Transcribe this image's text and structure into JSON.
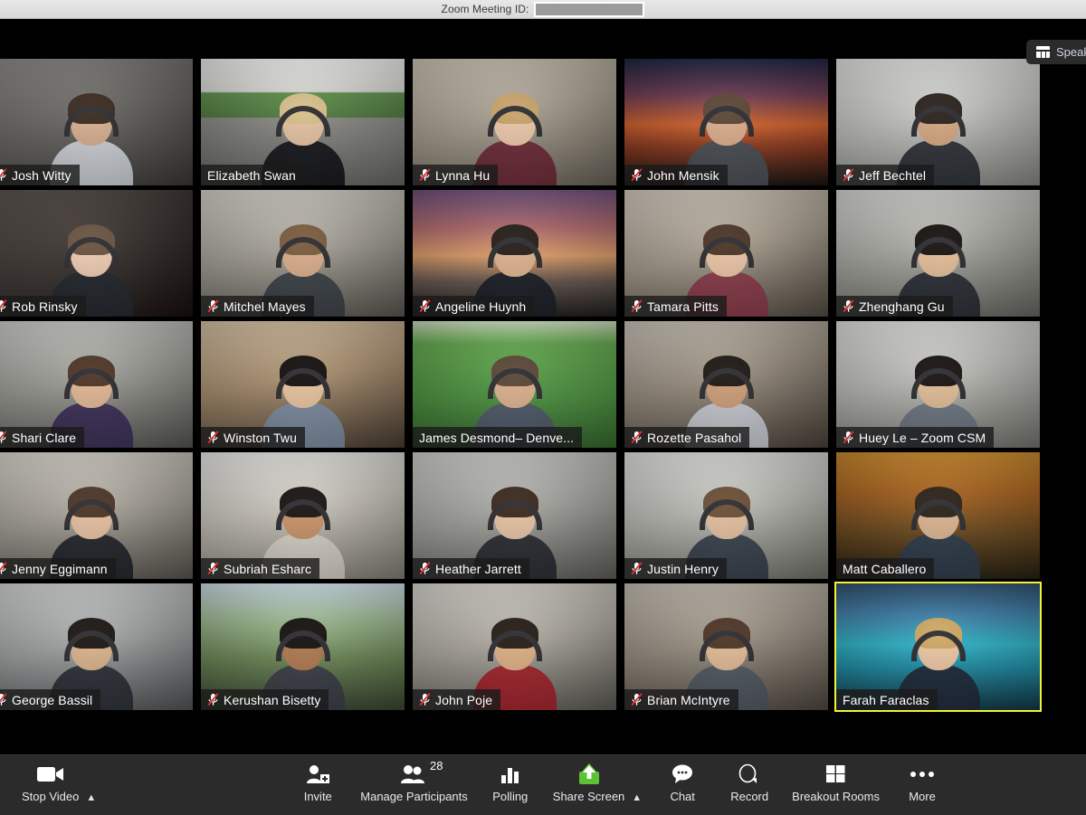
{
  "window": {
    "meeting_id_label": "Zoom Meeting ID:",
    "meeting_id_value": ""
  },
  "view_switch": {
    "label": "Speaker View",
    "icon": "grid-view-icon"
  },
  "gallery": {
    "participants": [
      {
        "name": "Josh Witty",
        "muted": true,
        "active_speaker": false,
        "scene": "office-open",
        "skin": "#d8b091",
        "hair": "#3a2a1e",
        "shirt": "#cfd3d8"
      },
      {
        "name": "Elizabeth Swan",
        "muted": false,
        "active_speaker": false,
        "scene": "office-green",
        "skin": "#e7c3a4",
        "hair": "#d8c08a",
        "shirt": "#17181c"
      },
      {
        "name": "Lynna Hu",
        "muted": true,
        "active_speaker": false,
        "scene": "cubicle-beige",
        "skin": "#edc9ab",
        "hair": "#c9a46b",
        "shirt": "#6e2b38"
      },
      {
        "name": "John Mensik",
        "muted": true,
        "active_speaker": false,
        "scene": "sunset-bg",
        "skin": "#dcae8c",
        "hair": "#5b4636",
        "shirt": "#4a4f55"
      },
      {
        "name": "Jeff Bechtel",
        "muted": true,
        "active_speaker": false,
        "scene": "office-white",
        "skin": "#d6a882",
        "hair": "#2a211c",
        "shirt": "#2f3338"
      },
      {
        "name": "Rob Rinsky",
        "muted": true,
        "active_speaker": false,
        "scene": "closeup-dark",
        "skin": "#f0cdb2",
        "hair": "#6a5340",
        "shirt": "#22262b"
      },
      {
        "name": "Mitchel Mayes",
        "muted": true,
        "active_speaker": false,
        "scene": "cubicle-gray",
        "skin": "#dcae8c",
        "hair": "#7a5c3c",
        "shirt": "#3c4248"
      },
      {
        "name": "Angeline Huynh",
        "muted": true,
        "active_speaker": false,
        "scene": "bridge-bg",
        "skin": "#e0b48f",
        "hair": "#241c17",
        "shirt": "#1b1f26"
      },
      {
        "name": "Tamara Pitts",
        "muted": true,
        "active_speaker": false,
        "scene": "office-warm",
        "skin": "#ecc6a7",
        "hair": "#4b3526",
        "shirt": "#8a3b4a"
      },
      {
        "name": "Zhenghang Gu",
        "muted": true,
        "active_speaker": false,
        "scene": "office-hall",
        "skin": "#e6c09a",
        "hair": "#15120f",
        "shirt": "#2b2f36"
      },
      {
        "name": "Shari Clare",
        "muted": true,
        "active_speaker": false,
        "scene": "office-desks",
        "skin": "#e3b994",
        "hair": "#4e3526",
        "shirt": "#3c2f58"
      },
      {
        "name": "Winston Twu",
        "muted": true,
        "active_speaker": false,
        "scene": "corridor-warm",
        "skin": "#e9c49f",
        "hair": "#120f0d",
        "shirt": "#7d8da1"
      },
      {
        "name": "James Desmond– Denve...",
        "muted": false,
        "active_speaker": false,
        "scene": "greenscreen",
        "skin": "#ddb28d",
        "hair": "#5a4636",
        "shirt": "#4f5a68"
      },
      {
        "name": "Rozette Pasahol",
        "muted": true,
        "active_speaker": false,
        "scene": "room-shelf",
        "skin": "#cf9f78",
        "hair": "#1d1713",
        "shirt": "#c9ccd2"
      },
      {
        "name": "Huey Le – Zoom CSM",
        "muted": true,
        "active_speaker": false,
        "scene": "office-bright",
        "skin": "#e2be97",
        "hair": "#171210",
        "shirt": "#6e7783"
      },
      {
        "name": "Jenny Eggimann",
        "muted": true,
        "active_speaker": false,
        "scene": "office-desk2",
        "skin": "#e8c1a0",
        "hair": "#4a3526",
        "shirt": "#23262b"
      },
      {
        "name": "Subriah Esharc",
        "muted": true,
        "active_speaker": false,
        "scene": "window-room",
        "skin": "#c99468",
        "hair": "#181311",
        "shirt": "#d8d2c8"
      },
      {
        "name": "Heather Jarrett",
        "muted": true,
        "active_speaker": false,
        "scene": "gray-wall",
        "skin": "#e8c4a4",
        "hair": "#3a281d",
        "shirt": "#2a2d33"
      },
      {
        "name": "Justin Henry",
        "muted": true,
        "active_speaker": false,
        "scene": "office-light",
        "skin": "#e6c0a0",
        "hair": "#6b4f36",
        "shirt": "#39424e"
      },
      {
        "name": "Matt Caballero",
        "muted": false,
        "active_speaker": false,
        "scene": "autumn-bg",
        "skin": "#dcb692",
        "hair": "#2b2118",
        "shirt": "#2e3b4a"
      },
      {
        "name": "George Bassil",
        "muted": true,
        "active_speaker": false,
        "scene": "office-cool",
        "skin": "#dcb48d",
        "hair": "#1b1512",
        "shirt": "#2c3138"
      },
      {
        "name": "Kerushan Bisetty",
        "muted": true,
        "active_speaker": false,
        "scene": "backyard",
        "skin": "#b07a50",
        "hair": "#14100e",
        "shirt": "#3a3f46"
      },
      {
        "name": "John Poje",
        "muted": true,
        "active_speaker": false,
        "scene": "office-desk3",
        "skin": "#dfb086",
        "hair": "#251b15",
        "shirt": "#a3242c"
      },
      {
        "name": "Brian McIntyre",
        "muted": true,
        "active_speaker": false,
        "scene": "art-wall",
        "skin": "#e2bb95",
        "hair": "#4c3525",
        "shirt": "#515861"
      },
      {
        "name": "Farah Faraclas",
        "muted": false,
        "active_speaker": true,
        "scene": "lake-bg",
        "skin": "#efc8a5",
        "hair": "#cfa964",
        "shirt": "#1d2a3b"
      }
    ]
  },
  "toolbar": {
    "video": {
      "label": "Stop Video",
      "icon": "camera-icon",
      "caret": "chevron-up-icon"
    },
    "invite": {
      "label": "Invite",
      "icon": "person-add-icon"
    },
    "participants": {
      "label": "Manage Participants",
      "icon": "people-icon",
      "count": "28"
    },
    "polling": {
      "label": "Polling",
      "icon": "bar-chart-icon"
    },
    "share": {
      "label": "Share Screen",
      "icon": "share-arrow-icon",
      "caret": "chevron-up-icon",
      "color": "#5bc236"
    },
    "chat": {
      "label": "Chat",
      "icon": "chat-bubble-icon"
    },
    "record": {
      "label": "Record",
      "icon": "record-circle-icon",
      "caret": "chevron-up-icon"
    },
    "breakout": {
      "label": "Breakout Rooms",
      "icon": "grid-squares-icon"
    },
    "more": {
      "label": "More",
      "icon": "ellipsis-icon"
    }
  },
  "colors": {
    "toolbar_bg": "#2b2b2b",
    "stage_bg": "#000000",
    "active_speaker": "#f2f23a",
    "share_green": "#5bc236"
  }
}
